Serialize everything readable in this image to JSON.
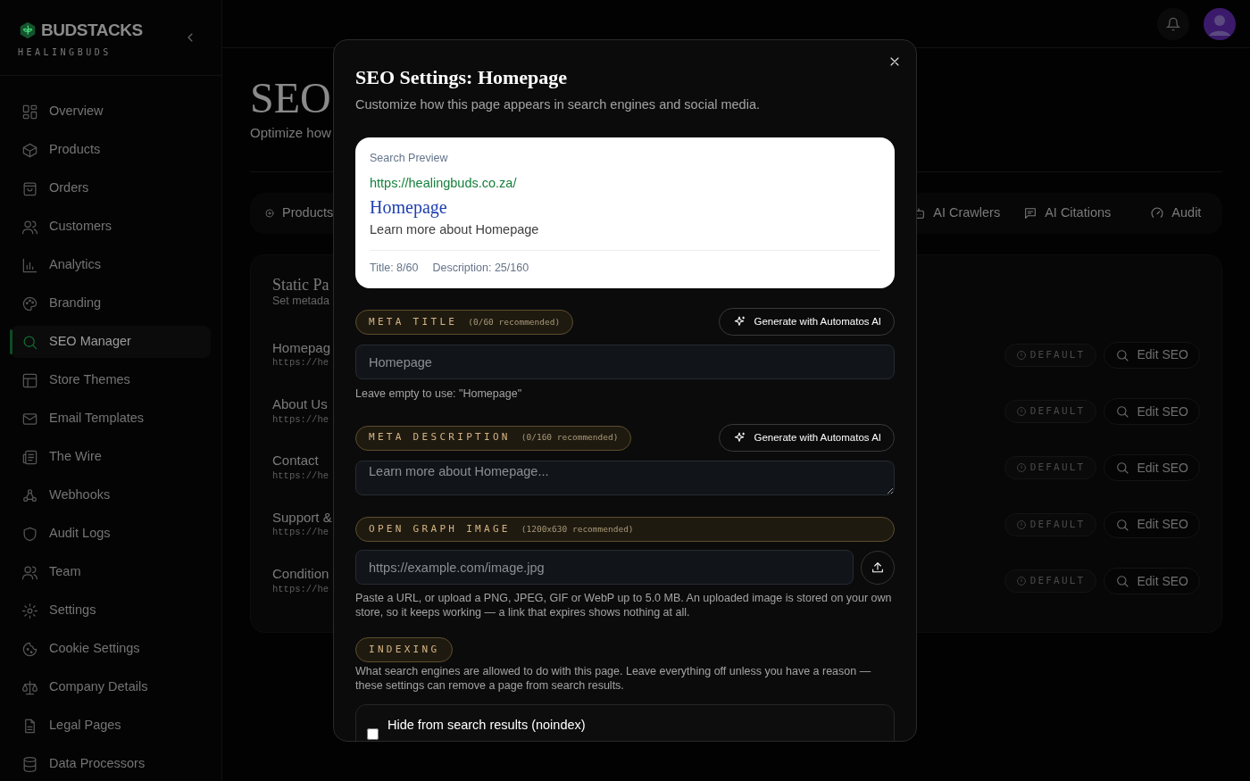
{
  "sidebar": {
    "brand": "BUDSTACKS",
    "store": "HEALINGBUDS",
    "items": [
      {
        "label": "Overview",
        "selected": false
      },
      {
        "label": "Products",
        "selected": false
      },
      {
        "label": "Orders",
        "selected": false
      },
      {
        "label": "Customers",
        "selected": false
      },
      {
        "label": "Analytics",
        "selected": false
      },
      {
        "label": "Branding",
        "selected": false
      },
      {
        "label": "SEO Manager",
        "selected": true
      },
      {
        "label": "Store Themes",
        "selected": false
      },
      {
        "label": "Email Templates",
        "selected": false
      },
      {
        "label": "The Wire",
        "selected": false
      },
      {
        "label": "Webhooks",
        "selected": false
      },
      {
        "label": "Audit Logs",
        "selected": false
      },
      {
        "label": "Team",
        "selected": false
      },
      {
        "label": "Settings",
        "selected": false
      },
      {
        "label": "Cookie Settings",
        "selected": false
      },
      {
        "label": "Company Details",
        "selected": false
      },
      {
        "label": "Legal Pages",
        "selected": false
      },
      {
        "label": "Data Processors",
        "selected": false
      }
    ]
  },
  "page": {
    "title": "SEO",
    "subtitle": "Optimize how",
    "tabs": [
      {
        "label": "Products"
      },
      {
        "label": "AI Crawlers"
      },
      {
        "label": "AI Citations"
      },
      {
        "label": "Audit"
      }
    ],
    "card": {
      "title": "Static Pa",
      "subtitle": "Set metada",
      "rows": [
        {
          "name": "Homepag",
          "url": "https://he",
          "badge": "DEFAULT",
          "action": "Edit SEO"
        },
        {
          "name": "About Us",
          "url": "https://he",
          "badge": "DEFAULT",
          "action": "Edit SEO"
        },
        {
          "name": "Contact",
          "url": "https://he",
          "badge": "DEFAULT",
          "action": "Edit SEO"
        },
        {
          "name": "Support &",
          "url": "https://he",
          "badge": "DEFAULT",
          "action": "Edit SEO"
        },
        {
          "name": "Condition",
          "url": "https://he",
          "badge": "DEFAULT",
          "action": "Edit SEO"
        }
      ]
    }
  },
  "modal": {
    "title": "SEO Settings: Homepage",
    "subtitle": "Customize how this page appears in search engines and social media.",
    "preview": {
      "label": "Search Preview",
      "url": "https://healingbuds.co.za/",
      "title": "Homepage",
      "description": "Learn more about Homepage",
      "counts": [
        "Title: 8/60",
        "Description: 25/160"
      ]
    },
    "sections": [
      {
        "kind": "text",
        "label": "META TITLE",
        "note": "(0/60 recommended)",
        "button": "Generate with Automatos AI",
        "placeholder": "Homepage",
        "help": "Leave empty to use: \"Homepage\""
      },
      {
        "kind": "textarea",
        "label": "META DESCRIPTION",
        "note": "(0/160 recommended)",
        "button": "Generate with Automatos AI",
        "placeholder": "Learn more about Homepage..."
      },
      {
        "kind": "image",
        "label": "OPEN GRAPH IMAGE",
        "note": "(1200x630 recommended)",
        "placeholder": "https://example.com/image.jpg",
        "help": "Paste a URL, or upload a PNG, JPEG, GIF or WebP up to 5.0 MB. An uploaded image is stored on your own store, so it keeps working — a link that expires shows nothing at all."
      },
      {
        "kind": "options",
        "label": "INDEXING",
        "help": "What search engines are allowed to do with this page. Leave everything off unless you have a reason — these settings can remove a page from search results.",
        "options": [
          {
            "label": "Hide from search results (noindex)",
            "checked": false
          }
        ]
      }
    ]
  }
}
